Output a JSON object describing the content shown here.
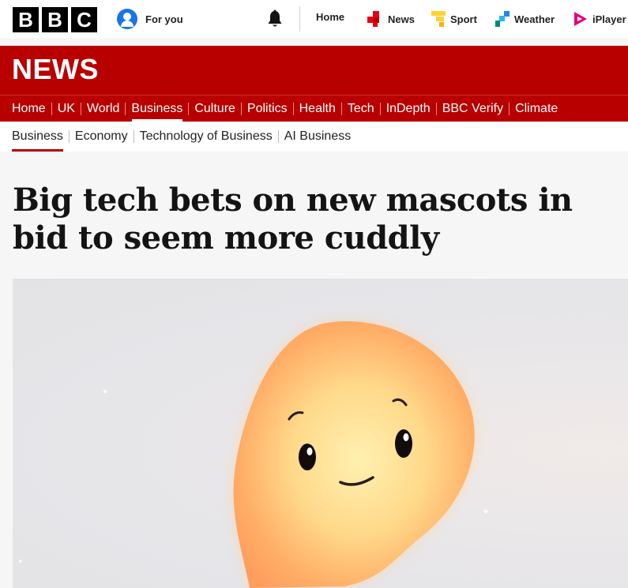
{
  "topbar": {
    "logo_letters": [
      "B",
      "B",
      "C"
    ],
    "for_you": "For you",
    "notifications_icon": "bell-icon",
    "links": [
      {
        "label": "Home",
        "icon": ""
      },
      {
        "label": "News",
        "icon": "news-icon"
      },
      {
        "label": "Sport",
        "icon": "sport-icon"
      },
      {
        "label": "Weather",
        "icon": "weather-icon"
      },
      {
        "label": "iPlayer",
        "icon": "iplayer-icon"
      }
    ]
  },
  "brand": {
    "news_title": "NEWS",
    "brand_color": "#b80000"
  },
  "nav": {
    "items": [
      "Home",
      "UK",
      "World",
      "Business",
      "Culture",
      "Politics",
      "Health",
      "Tech",
      "InDepth",
      "BBC Verify",
      "Climate"
    ],
    "active": "Business"
  },
  "subnav": {
    "items": [
      "Business",
      "Economy",
      "Technology of Business",
      "AI Business"
    ],
    "active": "Business"
  },
  "article": {
    "headline": "Big tech bets on new mascots in bid to seem more cuddly"
  }
}
